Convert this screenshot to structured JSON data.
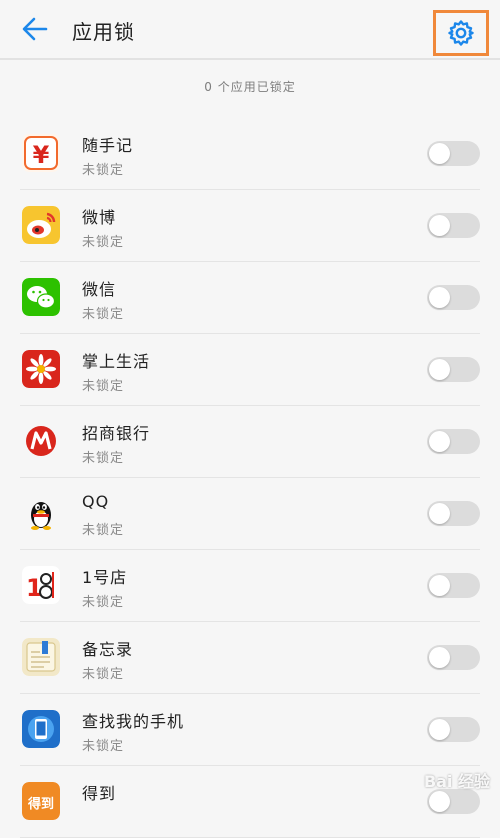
{
  "header": {
    "title": "应用锁",
    "back_icon": "arrow-left-icon",
    "settings_icon": "gear-icon"
  },
  "status_text": "0 个应用已锁定",
  "apps": [
    {
      "name": "随手记",
      "status": "未锁定",
      "icon": "wallet-yen-icon",
      "icon_color": "#f26a2d"
    },
    {
      "name": "微博",
      "status": "未锁定",
      "icon": "weibo-icon",
      "icon_color": "#f5c32c"
    },
    {
      "name": "微信",
      "status": "未锁定",
      "icon": "wechat-icon",
      "icon_color": "#2dc100"
    },
    {
      "name": "掌上生活",
      "status": "未锁定",
      "icon": "flower-icon",
      "icon_color": "#d9261c"
    },
    {
      "name": "招商银行",
      "status": "未锁定",
      "icon": "cmb-bank-icon",
      "icon_color": "#d9261c"
    },
    {
      "name": "QQ",
      "status": "未锁定",
      "icon": "qq-penguin-icon",
      "icon_color": "#000000"
    },
    {
      "name": "1号店",
      "status": "未锁定",
      "icon": "yihaodian-icon",
      "icon_color": "#e0251b"
    },
    {
      "name": "备忘录",
      "status": "未锁定",
      "icon": "memo-icon",
      "icon_color": "#e9d9a6"
    },
    {
      "name": "查找我的手机",
      "status": "未锁定",
      "icon": "find-phone-icon",
      "icon_color": "#1f6fc9"
    },
    {
      "name": "得到",
      "status": "",
      "icon": "dedao-icon",
      "icon_color": "#f08a24"
    }
  ],
  "toggle_state": "off",
  "watermark": "Bai 经验"
}
